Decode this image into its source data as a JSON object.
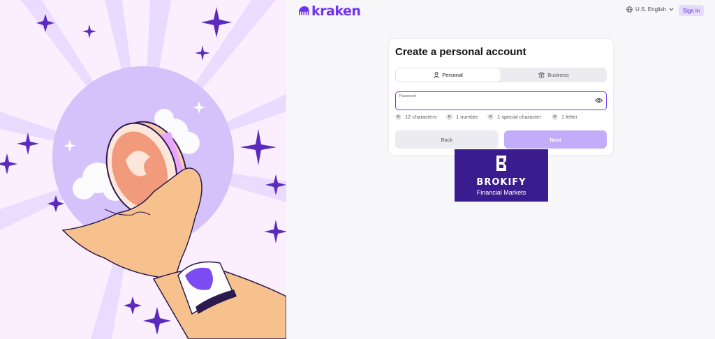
{
  "brand": {
    "logo_text": "kraken",
    "accent": "#7132f5"
  },
  "topbar": {
    "language": "U.S. English",
    "sign_in": "Sign in"
  },
  "card": {
    "title": "Create a personal account",
    "tabs": [
      {
        "label": "Personal",
        "icon": "person-icon",
        "active": true
      },
      {
        "label": "Business",
        "icon": "bank-icon",
        "active": false
      }
    ],
    "password": {
      "label": "Password",
      "value": ""
    },
    "requirements": [
      "12 characters",
      "1 number",
      "1 special character",
      "1 letter"
    ],
    "back": "Back",
    "next": "Next"
  },
  "badge": {
    "name": "BROKIFY",
    "sub": "Financial Markets",
    "bg": "#3b1c8e"
  },
  "colors": {
    "left_bg": "#fbefff",
    "next_disabled": "#c3acfa",
    "signin_bg": "#e6dcff"
  }
}
